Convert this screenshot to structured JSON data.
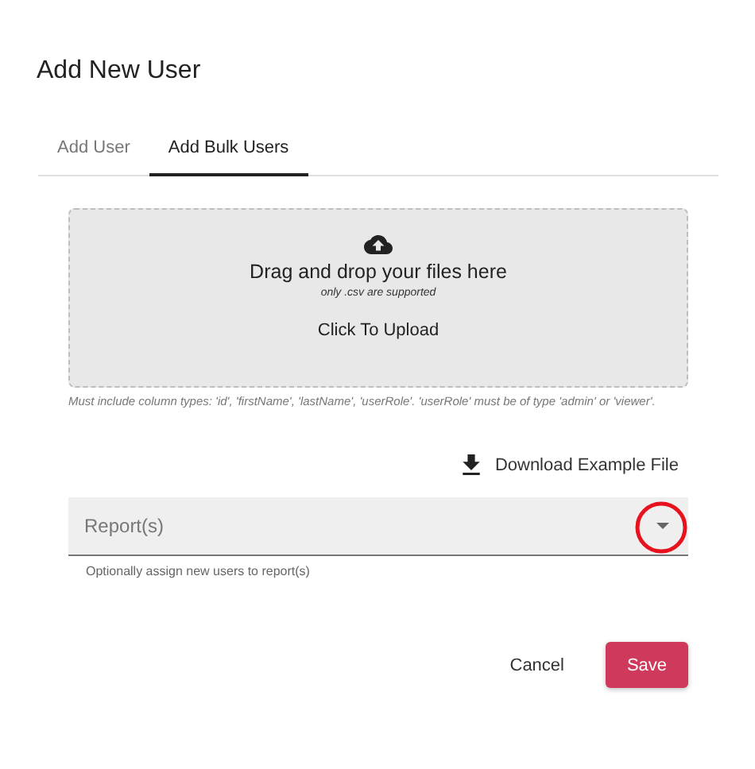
{
  "dialog": {
    "title": "Add New User"
  },
  "tabs": [
    {
      "label": "Add User",
      "selected": false
    },
    {
      "label": "Add Bulk Users",
      "selected": true
    }
  ],
  "dropzone": {
    "heading": "Drag and drop your files here",
    "note": "only .csv are supported",
    "action": "Click To Upload"
  },
  "dropzone_help": "Must include column types: 'id', 'firstName', 'lastName', 'userRole'. 'userRole' must be of type 'admin' or 'viewer'.",
  "download_button": "Download Example File",
  "reports_select": {
    "placeholder": "Report(s)",
    "help": "Optionally assign new users to report(s)",
    "highlighted": true
  },
  "buttons": [
    {
      "label": "Cancel",
      "kind": "text"
    },
    {
      "label": "Save",
      "kind": "primary"
    }
  ]
}
